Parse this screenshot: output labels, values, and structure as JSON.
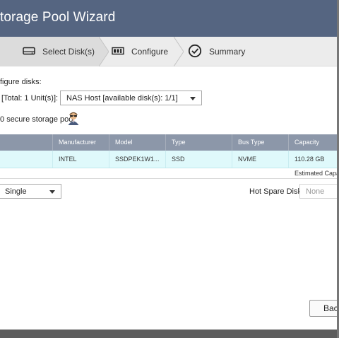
{
  "window": {
    "title": "torage Pool Wizard"
  },
  "steps": [
    {
      "label": "Select Disk(s)",
      "icon": "hard-drive-icon",
      "active": true
    },
    {
      "label": "Configure",
      "icon": "configure-icon",
      "active": false
    },
    {
      "label": "Summary",
      "icon": "checkmark-circle-icon",
      "active": false
    }
  ],
  "config": {
    "heading": "figure disks:",
    "enclosure_label": "[Total: 1 Unit(s)]:",
    "enclosure_value": "NAS Host [available disk(s): 1/1]",
    "secure_label": "secure storage pool",
    "secure_prefix": "0"
  },
  "table": {
    "columns": [
      "",
      "Manufacturer",
      "Model",
      "Type",
      "Bus Type",
      "Capacity"
    ],
    "rows": [
      {
        "cells": [
          "",
          "INTEL",
          "SSDPEK1W1...",
          "SSD",
          "NVME",
          "110.28 GB"
        ]
      }
    ],
    "estimated_label": "Estimated Capa"
  },
  "raid": {
    "value": "Single"
  },
  "hot_spare": {
    "label": "Hot Spare Disk:",
    "value": "None"
  },
  "buttons": {
    "back": "Back"
  },
  "colors": {
    "titlebar": "#556581",
    "table_header": "#8c97a9",
    "selected_row": "#dff9fb"
  }
}
